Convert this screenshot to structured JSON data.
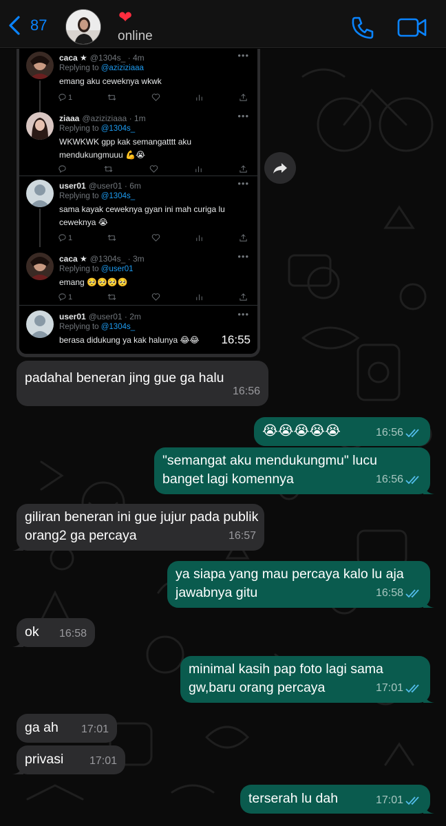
{
  "header": {
    "back_count": "87",
    "status": "online",
    "heart": "❤"
  },
  "icons": {
    "back": "chevron-left-icon",
    "call": "phone-icon",
    "video": "video-camera-icon",
    "forward": "forward-arrow-icon",
    "read_receipt": "double-check-icon"
  },
  "colors": {
    "accent": "#0a84ff",
    "incoming_bubble": "#2c2c2e",
    "outgoing_bubble": "#0a5b4e",
    "read_tick": "#53bdeb",
    "twitter_link": "#1d9bf0"
  },
  "screenshot": {
    "time": "16:55",
    "tweets": [
      {
        "name": "caca ★",
        "handle": "@1304s_ · 4m",
        "replying_label": "Replying to ",
        "replying_to": "@aziziziaaa",
        "text": "emang aku ceweknya wkwk",
        "reply_count": "1"
      },
      {
        "name": "ziaaa",
        "handle": "@aziziziaaa · 1m",
        "replying_label": "Replying to ",
        "replying_to": "@1304s_",
        "text": "WKWKWK gpp kak semangatttt aku mendukungmuuu 💪😭",
        "reply_count": ""
      },
      {
        "name": "user01",
        "handle": "@user01 · 6m",
        "replying_label": "Replying to ",
        "replying_to": "@1304s_",
        "text": "sama kayak ceweknya gyan ini mah curiga lu ceweknya 😭",
        "reply_count": "1"
      },
      {
        "name": "caca ★",
        "handle": "@1304s_ · 3m",
        "replying_label": "Replying to ",
        "replying_to": "@user01",
        "text": "emang 🥺🥺🥺🥺",
        "reply_count": "1"
      },
      {
        "name": "user01",
        "handle": "@user01 · 2m",
        "replying_label": "Replying to ",
        "replying_to": "@1304s_",
        "text": "berasa didukung ya kak halunya 😂😂",
        "reply_count": ""
      }
    ]
  },
  "messages": [
    {
      "dir": "in",
      "text": "padahal beneran jing gue ga halu",
      "time": "16:56"
    },
    {
      "dir": "out",
      "text": "😭😭😭😭😭",
      "time": "16:56"
    },
    {
      "dir": "out",
      "text": "\"semangat aku mendukungmu\" lucu banget lagi komennya",
      "time": "16:56"
    },
    {
      "dir": "in",
      "text": "giliran beneran ini gue jujur pada publik orang2 ga percaya",
      "time": "16:57"
    },
    {
      "dir": "out",
      "text": "ya siapa yang mau percaya kalo lu aja jawabnya gitu",
      "time": "16:58"
    },
    {
      "dir": "in",
      "text": "ok",
      "time": "16:58"
    },
    {
      "dir": "out",
      "text": "minimal kasih pap foto lagi sama gw,baru orang percaya",
      "time": "17:01"
    },
    {
      "dir": "in",
      "text": "ga ah",
      "time": "17:01"
    },
    {
      "dir": "in",
      "text": "privasi",
      "time": "17:01"
    },
    {
      "dir": "out",
      "text": "terserah lu dah",
      "time": "17:01"
    }
  ]
}
